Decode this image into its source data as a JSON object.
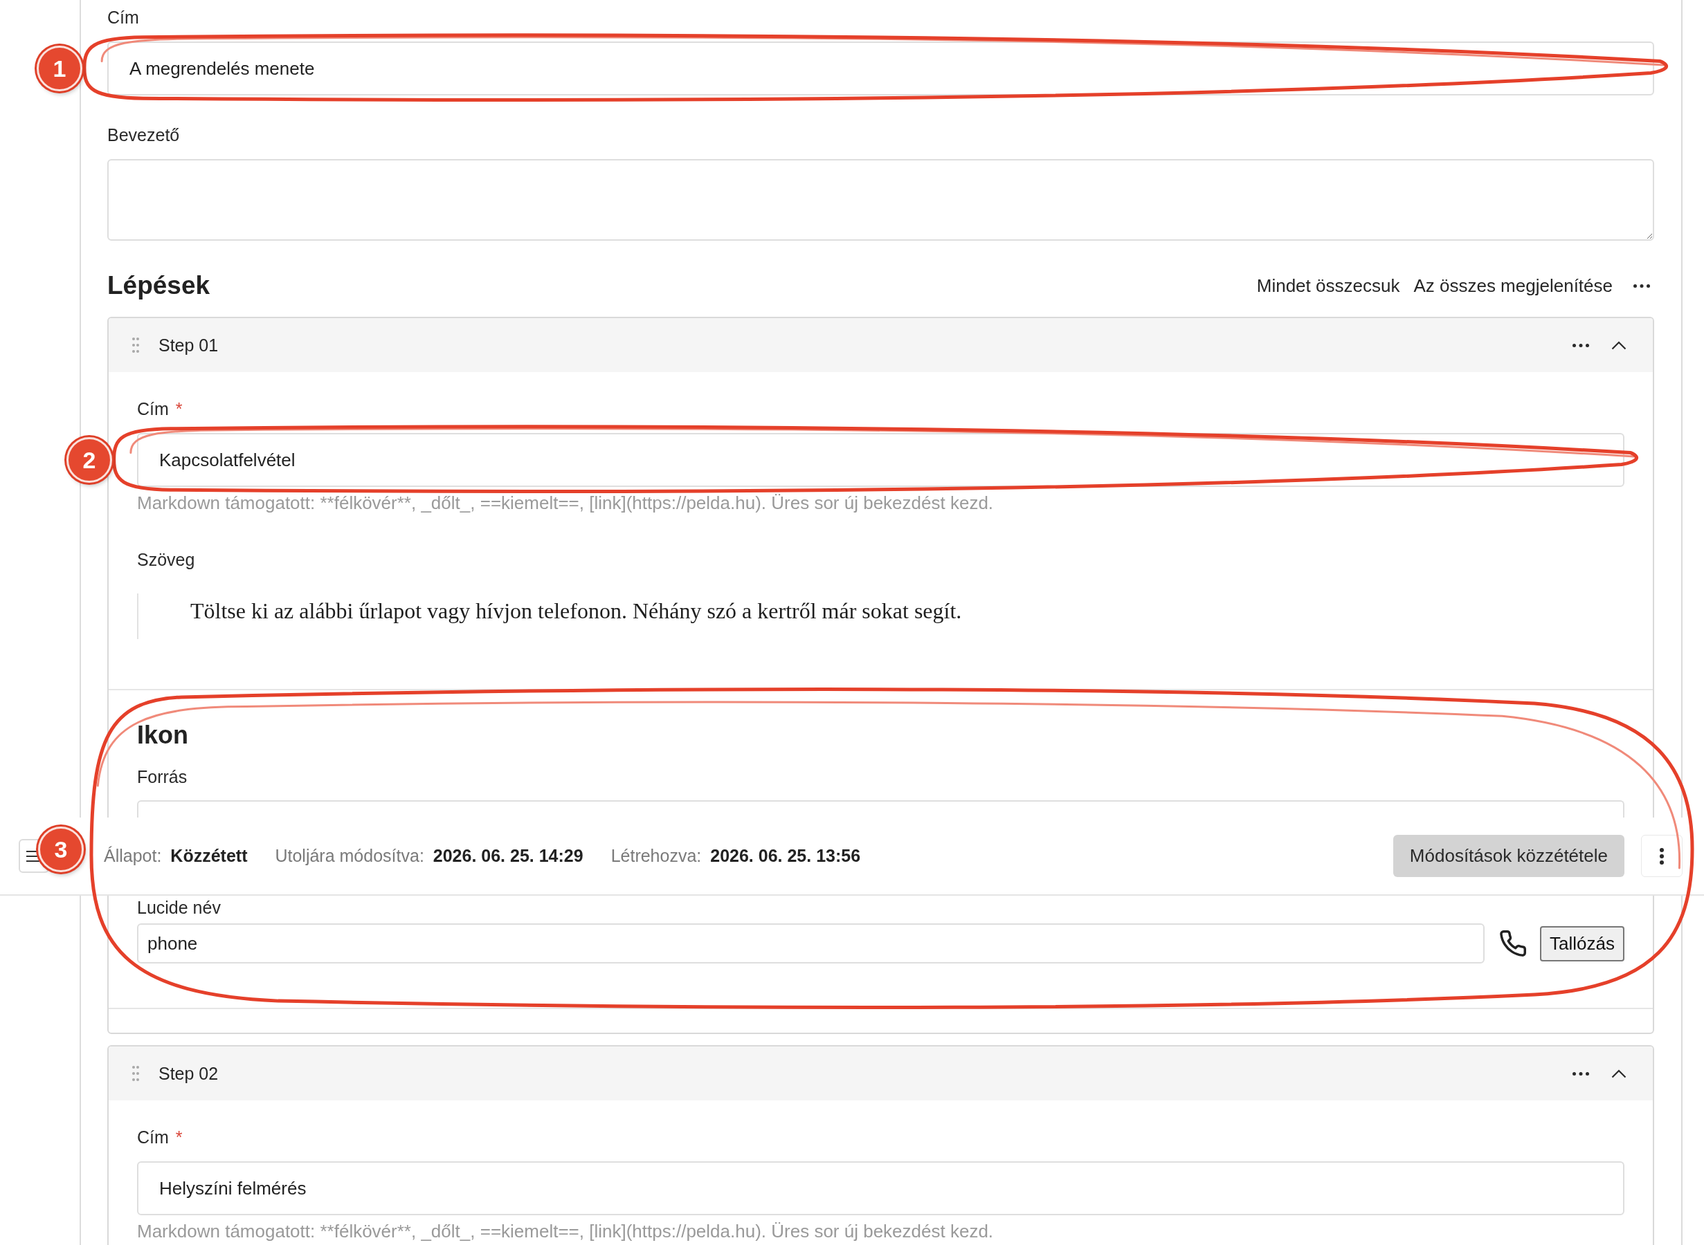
{
  "form": {
    "title_field": {
      "label": "Cím",
      "value": "A megrendelés menete",
      "annotation": "1"
    },
    "intro_field": {
      "label": "Bevezető"
    }
  },
  "steps": {
    "heading": "Lépések",
    "actions": [
      "Mindet összecsuk",
      "Az összes megjelenítése"
    ],
    "items": [
      {
        "title": "Step 01",
        "expanded": true,
        "title_field": {
          "label": "Cím",
          "required_mark": "*",
          "value": "Kapcsolatfelvétel",
          "hint": "Markdown támogatott: **félkövér**, _dőlt_, ==kiemelt==, [link](https://pelda.hu). Üres sor új bekezdést kezd.",
          "annotation": "2"
        },
        "text_field": {
          "label": "Szöveg",
          "value": "Töltse ki az alábbi űrlapot vagy hívjon telefonon. Néhány szó a kertről már sokat segít."
        },
        "icon_section": {
          "heading": "Ikon",
          "source_label": "Forrás",
          "name_label": "Lucide név",
          "name_value": "phone",
          "browse_button": "Tallózás",
          "annotation": "3"
        }
      },
      {
        "title": "Step 02",
        "expanded": true,
        "title_field": {
          "label": "Cím",
          "required_mark": "*",
          "value": "Helyszíni felmérés",
          "hint": "Markdown támogatott: **félkövér**, _dőlt_, ==kiemelt==, [link](https://pelda.hu). Üres sor új bekezdést kezd."
        }
      }
    ]
  },
  "status_bar": {
    "meta": [
      {
        "label": "Állapot:",
        "value": "Közzétett"
      },
      {
        "label": "Utoljára módosítva:",
        "value": "2026. 06. 25. 14:29"
      },
      {
        "label": "Létrehozva:",
        "value": "2026. 06. 25. 13:56"
      }
    ],
    "publish_button": "Módosítások közzététele"
  }
}
